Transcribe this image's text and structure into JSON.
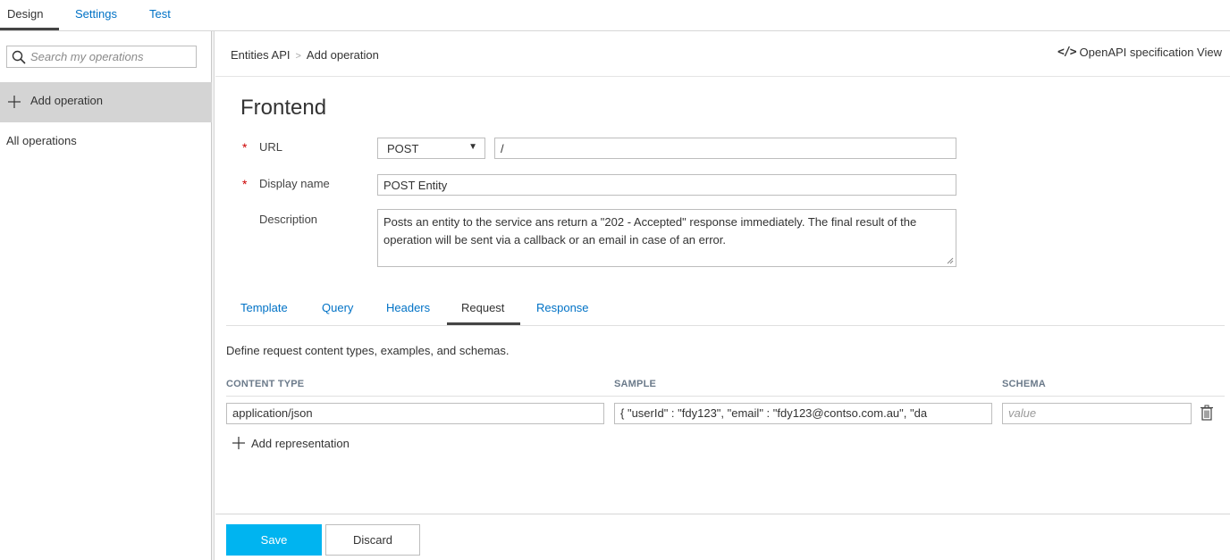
{
  "top_tabs": [
    {
      "label": "Design"
    },
    {
      "label": "Settings"
    },
    {
      "label": "Test"
    }
  ],
  "sidebar": {
    "search_placeholder": "Search my operations",
    "add_operation_label": "Add operation",
    "all_operations_label": "All operations"
  },
  "header": {
    "breadcrumb_root": "Entities API",
    "breadcrumb_separator": ">",
    "breadcrumb_current": "Add operation",
    "openapi_icon": "</>",
    "openapi_label": "OpenAPI specification View"
  },
  "form": {
    "title": "Frontend",
    "url_label": "URL",
    "required_marker": "*",
    "method_value": "POST",
    "method_caret": "▼",
    "url_value": "/",
    "display_name_label": "Display name",
    "display_name_value": "POST Entity",
    "description_label": "Description",
    "description_value": "Posts an entity to the service ans return a \"202 - Accepted\" response immediately. The final result of the operation will be sent via a callback or an email in case of an error."
  },
  "sub_tabs": [
    {
      "label": "Template"
    },
    {
      "label": "Query"
    },
    {
      "label": "Headers"
    },
    {
      "label": "Request"
    },
    {
      "label": "Response"
    }
  ],
  "request": {
    "intro": "Define request content types, examples, and schemas.",
    "columns": [
      "CONTENT TYPE",
      "SAMPLE",
      "SCHEMA"
    ],
    "rows": [
      {
        "content_type": "application/json",
        "sample": "{       \"userId\" : \"fdy123\",  \"email\" : \"fdy123@contso.com.au\",        \"da",
        "schema_placeholder": "value"
      }
    ],
    "add_representation_label": "Add representation"
  },
  "footer": {
    "save_label": "Save",
    "discard_label": "Discard"
  },
  "colors": {
    "accent": "#0072c6",
    "save_button": "#00b4f0",
    "required": "#cc0000",
    "selected_bg": "#d4d4d4"
  }
}
